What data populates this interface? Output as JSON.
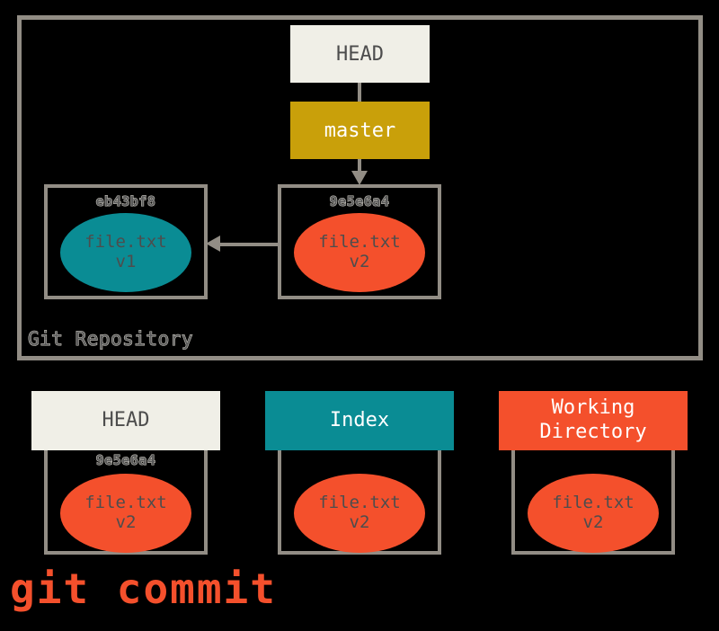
{
  "colors": {
    "background": "#000000",
    "border_grey": "#928d85",
    "cream": "#f0efe7",
    "gold": "#c9a00a",
    "teal": "#0a8c94",
    "red_orange": "#f4502c",
    "text_dark": "#4d4d4d",
    "text_white": "#ffffff"
  },
  "repository": {
    "label": "Git Repository",
    "refs": [
      {
        "name": "head-ref",
        "label": "HEAD"
      },
      {
        "name": "master-ref",
        "label": "master"
      }
    ],
    "commits": [
      {
        "hash": "eb43bf8",
        "file": "file.txt",
        "version": "v1",
        "blob_color": "teal"
      },
      {
        "hash": "9e5e6a4",
        "file": "file.txt",
        "version": "v2",
        "blob_color": "red"
      }
    ],
    "parent_arrow": {
      "from": "9e5e6a4",
      "to": "eb43bf8",
      "direction": "left"
    },
    "ref_arrow": {
      "from": "master",
      "to": "9e5e6a4",
      "direction": "down"
    }
  },
  "areas": [
    {
      "id": "head",
      "title": "HEAD",
      "hash": "9e5e6a4",
      "file": "file.txt",
      "version": "v2",
      "header_color": "#f0efe7",
      "blob_color": "red"
    },
    {
      "id": "index",
      "title": "Index",
      "hash": "",
      "file": "file.txt",
      "version": "v2",
      "header_color": "#0a8c94",
      "blob_color": "red"
    },
    {
      "id": "working-directory",
      "title_line1": "Working",
      "title_line2": "Directory",
      "hash": "",
      "file": "file.txt",
      "version": "v2",
      "header_color": "#f4502c",
      "blob_color": "red"
    }
  ],
  "caption": {
    "command": "git commit"
  }
}
